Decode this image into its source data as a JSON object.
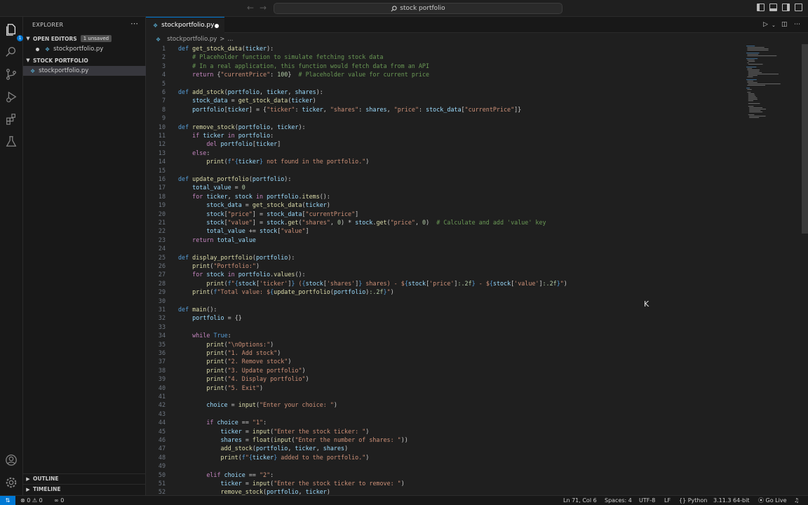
{
  "titlebar": {
    "search_text": "stock portfolio",
    "back_icon": "arrow-left-icon",
    "forward_icon": "arrow-right-icon"
  },
  "activity": {
    "badge": "1"
  },
  "sidebar": {
    "title": "EXPLORER",
    "open_editors_label": "OPEN EDITORS",
    "unsaved_badge": "1 unsaved",
    "open_editor_file": "stockportfolio.py",
    "folder_label": "STOCK PORTFOLIO",
    "folder_file": "stockportfolio.py",
    "outline_label": "OUTLINE",
    "timeline_label": "TIMELINE"
  },
  "tabs": [
    {
      "label": "stockportfolio.py",
      "dirty": true
    }
  ],
  "breadcrumb": {
    "file": "stockportfolio.py",
    "separator": ">",
    "rest": "..."
  },
  "editor": {
    "first_line": 1,
    "lines": [
      [
        [
          "kw",
          "def "
        ],
        [
          "fn",
          "get_stock_data"
        ],
        [
          "",
          "("
        ],
        [
          "var",
          "ticker"
        ],
        [
          "",
          "):"
        ]
      ],
      [
        [
          "",
          "    "
        ],
        [
          "cm",
          "# Placeholder function to simulate fetching stock data"
        ]
      ],
      [
        [
          "",
          "    "
        ],
        [
          "cm",
          "# In a real application, this function would fetch data from an API"
        ]
      ],
      [
        [
          "",
          "    "
        ],
        [
          "ctl",
          "return "
        ],
        [
          "",
          "{"
        ],
        [
          "str",
          "\"currentPrice\""
        ],
        [
          "",
          ": "
        ],
        [
          "num",
          "100"
        ],
        [
          "",
          "}  "
        ],
        [
          "cm",
          "# Placeholder value for current price"
        ]
      ],
      [],
      [
        [
          "kw",
          "def "
        ],
        [
          "fn",
          "add_stock"
        ],
        [
          "",
          "("
        ],
        [
          "var",
          "portfolio"
        ],
        [
          "",
          ", "
        ],
        [
          "var",
          "ticker"
        ],
        [
          "",
          ", "
        ],
        [
          "var",
          "shares"
        ],
        [
          "",
          "):"
        ]
      ],
      [
        [
          "",
          "    "
        ],
        [
          "var",
          "stock_data"
        ],
        [
          "",
          " = "
        ],
        [
          "fn",
          "get_stock_data"
        ],
        [
          "",
          "("
        ],
        [
          "var",
          "ticker"
        ],
        [
          "",
          ")"
        ]
      ],
      [
        [
          "",
          "    "
        ],
        [
          "var",
          "portfolio"
        ],
        [
          "",
          "["
        ],
        [
          "var",
          "ticker"
        ],
        [
          "",
          "] = {"
        ],
        [
          "str",
          "\"ticker\""
        ],
        [
          "",
          ": "
        ],
        [
          "var",
          "ticker"
        ],
        [
          "",
          ", "
        ],
        [
          "str",
          "\"shares\""
        ],
        [
          "",
          ": "
        ],
        [
          "var",
          "shares"
        ],
        [
          "",
          ", "
        ],
        [
          "str",
          "\"price\""
        ],
        [
          "",
          ": "
        ],
        [
          "var",
          "stock_data"
        ],
        [
          "",
          "["
        ],
        [
          "str",
          "\"currentPrice\""
        ],
        [
          "",
          "]}"
        ]
      ],
      [],
      [
        [
          "kw",
          "def "
        ],
        [
          "fn",
          "remove_stock"
        ],
        [
          "",
          "("
        ],
        [
          "var",
          "portfolio"
        ],
        [
          "",
          ", "
        ],
        [
          "var",
          "ticker"
        ],
        [
          "",
          "):"
        ]
      ],
      [
        [
          "",
          "    "
        ],
        [
          "ctl",
          "if "
        ],
        [
          "var",
          "ticker"
        ],
        [
          "ctl",
          " in "
        ],
        [
          "var",
          "portfolio"
        ],
        [
          "",
          ":"
        ]
      ],
      [
        [
          "",
          "        "
        ],
        [
          "ctl",
          "del "
        ],
        [
          "var",
          "portfolio"
        ],
        [
          "",
          "["
        ],
        [
          "var",
          "ticker"
        ],
        [
          "",
          "]"
        ]
      ],
      [
        [
          "",
          "    "
        ],
        [
          "ctl",
          "else"
        ],
        [
          "",
          ":"
        ]
      ],
      [
        [
          "",
          "        "
        ],
        [
          "fn",
          "print"
        ],
        [
          "",
          "("
        ],
        [
          "kw",
          "f"
        ],
        [
          "str",
          "\""
        ],
        [
          "kw",
          "{"
        ],
        [
          "var",
          "ticker"
        ],
        [
          "kw",
          "}"
        ],
        [
          "str",
          " not found in the portfolio.\""
        ],
        [
          "",
          ")"
        ]
      ],
      [],
      [
        [
          "kw",
          "def "
        ],
        [
          "fn",
          "update_portfolio"
        ],
        [
          "",
          "("
        ],
        [
          "var",
          "portfolio"
        ],
        [
          "",
          "):"
        ]
      ],
      [
        [
          "",
          "    "
        ],
        [
          "var",
          "total_value"
        ],
        [
          "",
          " = "
        ],
        [
          "num",
          "0"
        ]
      ],
      [
        [
          "",
          "    "
        ],
        [
          "ctl",
          "for "
        ],
        [
          "var",
          "ticker"
        ],
        [
          "",
          ", "
        ],
        [
          "var",
          "stock"
        ],
        [
          "ctl",
          " in "
        ],
        [
          "var",
          "portfolio"
        ],
        [
          "",
          "."
        ],
        [
          "fn",
          "items"
        ],
        [
          "",
          "():"
        ]
      ],
      [
        [
          "",
          "        "
        ],
        [
          "var",
          "stock_data"
        ],
        [
          "",
          " = "
        ],
        [
          "fn",
          "get_stock_data"
        ],
        [
          "",
          "("
        ],
        [
          "var",
          "ticker"
        ],
        [
          "",
          ")"
        ]
      ],
      [
        [
          "",
          "        "
        ],
        [
          "var",
          "stock"
        ],
        [
          "",
          "["
        ],
        [
          "str",
          "\"price\""
        ],
        [
          "",
          "] = "
        ],
        [
          "var",
          "stock_data"
        ],
        [
          "",
          "["
        ],
        [
          "str",
          "\"currentPrice\""
        ],
        [
          "",
          "]"
        ]
      ],
      [
        [
          "",
          "        "
        ],
        [
          "var",
          "stock"
        ],
        [
          "",
          "["
        ],
        [
          "str",
          "\"value\""
        ],
        [
          "",
          "] = "
        ],
        [
          "var",
          "stock"
        ],
        [
          "",
          "."
        ],
        [
          "fn",
          "get"
        ],
        [
          "",
          "("
        ],
        [
          "str",
          "\"shares\""
        ],
        [
          "",
          ", "
        ],
        [
          "num",
          "0"
        ],
        [
          "",
          ") * "
        ],
        [
          "var",
          "stock"
        ],
        [
          "",
          "."
        ],
        [
          "fn",
          "get"
        ],
        [
          "",
          "("
        ],
        [
          "str",
          "\"price\""
        ],
        [
          "",
          ", "
        ],
        [
          "num",
          "0"
        ],
        [
          "",
          ")  "
        ],
        [
          "cm",
          "# Calculate and add 'value' key"
        ]
      ],
      [
        [
          "",
          "        "
        ],
        [
          "var",
          "total_value"
        ],
        [
          "",
          " += "
        ],
        [
          "var",
          "stock"
        ],
        [
          "",
          "["
        ],
        [
          "str",
          "\"value\""
        ],
        [
          "",
          "]"
        ]
      ],
      [
        [
          "",
          "    "
        ],
        [
          "ctl",
          "return "
        ],
        [
          "var",
          "total_value"
        ]
      ],
      [],
      [
        [
          "kw",
          "def "
        ],
        [
          "fn",
          "display_portfolio"
        ],
        [
          "",
          "("
        ],
        [
          "var",
          "portfolio"
        ],
        [
          "",
          "):"
        ]
      ],
      [
        [
          "",
          "    "
        ],
        [
          "fn",
          "print"
        ],
        [
          "",
          "("
        ],
        [
          "str",
          "\"Portfolio:\""
        ],
        [
          "",
          ")"
        ]
      ],
      [
        [
          "",
          "    "
        ],
        [
          "ctl",
          "for "
        ],
        [
          "var",
          "stock"
        ],
        [
          "ctl",
          " in "
        ],
        [
          "var",
          "portfolio"
        ],
        [
          "",
          "."
        ],
        [
          "fn",
          "values"
        ],
        [
          "",
          "():"
        ]
      ],
      [
        [
          "",
          "        "
        ],
        [
          "fn",
          "print"
        ],
        [
          "",
          "("
        ],
        [
          "kw",
          "f"
        ],
        [
          "str",
          "\""
        ],
        [
          "kw",
          "{"
        ],
        [
          "var",
          "stock"
        ],
        [
          "",
          "["
        ],
        [
          "str",
          "'ticker'"
        ],
        [
          "",
          "]"
        ],
        [
          "kw",
          "}"
        ],
        [
          "str",
          " ("
        ],
        [
          "kw",
          "{"
        ],
        [
          "var",
          "stock"
        ],
        [
          "",
          "["
        ],
        [
          "str",
          "'shares'"
        ],
        [
          "",
          "]"
        ],
        [
          "kw",
          "}"
        ],
        [
          "str",
          " shares) - $"
        ],
        [
          "kw",
          "{"
        ],
        [
          "var",
          "stock"
        ],
        [
          "",
          "["
        ],
        [
          "str",
          "'price'"
        ],
        [
          "",
          "]"
        ],
        [
          "num",
          ":.2f"
        ],
        [
          "kw",
          "}"
        ],
        [
          "str",
          " - $"
        ],
        [
          "kw",
          "{"
        ],
        [
          "var",
          "stock"
        ],
        [
          "",
          "["
        ],
        [
          "str",
          "'value'"
        ],
        [
          "",
          "]"
        ],
        [
          "num",
          ":.2f"
        ],
        [
          "kw",
          "}"
        ],
        [
          "str",
          "\""
        ],
        [
          "",
          ")"
        ]
      ],
      [
        [
          "",
          "    "
        ],
        [
          "fn",
          "print"
        ],
        [
          "",
          "("
        ],
        [
          "kw",
          "f"
        ],
        [
          "str",
          "\"Total value: $"
        ],
        [
          "kw",
          "{"
        ],
        [
          "fn",
          "update_portfolio"
        ],
        [
          "",
          "("
        ],
        [
          "var",
          "portfolio"
        ],
        [
          "",
          ")"
        ],
        [
          "num",
          ":.2f"
        ],
        [
          "kw",
          "}"
        ],
        [
          "str",
          "\""
        ],
        [
          "",
          ")"
        ]
      ],
      [],
      [
        [
          "kw",
          "def "
        ],
        [
          "fn",
          "main"
        ],
        [
          "",
          "():"
        ]
      ],
      [
        [
          "",
          "    "
        ],
        [
          "var",
          "portfolio"
        ],
        [
          "",
          " = {}"
        ]
      ],
      [],
      [
        [
          "",
          "    "
        ],
        [
          "ctl",
          "while "
        ],
        [
          "kw",
          "True"
        ],
        [
          "",
          ":"
        ]
      ],
      [
        [
          "",
          "        "
        ],
        [
          "fn",
          "print"
        ],
        [
          "",
          "("
        ],
        [
          "str",
          "\"\\nOptions:\""
        ],
        [
          "",
          ")"
        ]
      ],
      [
        [
          "",
          "        "
        ],
        [
          "fn",
          "print"
        ],
        [
          "",
          "("
        ],
        [
          "str",
          "\"1. Add stock\""
        ],
        [
          "",
          ")"
        ]
      ],
      [
        [
          "",
          "        "
        ],
        [
          "fn",
          "print"
        ],
        [
          "",
          "("
        ],
        [
          "str",
          "\"2. Remove stock\""
        ],
        [
          "",
          ")"
        ]
      ],
      [
        [
          "",
          "        "
        ],
        [
          "fn",
          "print"
        ],
        [
          "",
          "("
        ],
        [
          "str",
          "\"3. Update portfolio\""
        ],
        [
          "",
          ")"
        ]
      ],
      [
        [
          "",
          "        "
        ],
        [
          "fn",
          "print"
        ],
        [
          "",
          "("
        ],
        [
          "str",
          "\"4. Display portfolio\""
        ],
        [
          "",
          ")"
        ]
      ],
      [
        [
          "",
          "        "
        ],
        [
          "fn",
          "print"
        ],
        [
          "",
          "("
        ],
        [
          "str",
          "\"5. Exit\""
        ],
        [
          "",
          ")"
        ]
      ],
      [],
      [
        [
          "",
          "        "
        ],
        [
          "var",
          "choice"
        ],
        [
          "",
          " = "
        ],
        [
          "fn",
          "input"
        ],
        [
          "",
          "("
        ],
        [
          "str",
          "\"Enter your choice: \""
        ],
        [
          "",
          ")"
        ]
      ],
      [],
      [
        [
          "",
          "        "
        ],
        [
          "ctl",
          "if "
        ],
        [
          "var",
          "choice"
        ],
        [
          "",
          " == "
        ],
        [
          "str",
          "\"1\""
        ],
        [
          "",
          ":"
        ]
      ],
      [
        [
          "",
          "            "
        ],
        [
          "var",
          "ticker"
        ],
        [
          "",
          " = "
        ],
        [
          "fn",
          "input"
        ],
        [
          "",
          "("
        ],
        [
          "str",
          "\"Enter the stock ticker: \""
        ],
        [
          "",
          ")"
        ]
      ],
      [
        [
          "",
          "            "
        ],
        [
          "var",
          "shares"
        ],
        [
          "",
          " = "
        ],
        [
          "fn",
          "float"
        ],
        [
          "",
          "("
        ],
        [
          "fn",
          "input"
        ],
        [
          "",
          "("
        ],
        [
          "str",
          "\"Enter the number of shares: \""
        ],
        [
          "",
          "))"
        ]
      ],
      [
        [
          "",
          "            "
        ],
        [
          "fn",
          "add_stock"
        ],
        [
          "",
          "("
        ],
        [
          "var",
          "portfolio"
        ],
        [
          "",
          ", "
        ],
        [
          "var",
          "ticker"
        ],
        [
          "",
          ", "
        ],
        [
          "var",
          "shares"
        ],
        [
          "",
          ")"
        ]
      ],
      [
        [
          "",
          "            "
        ],
        [
          "fn",
          "print"
        ],
        [
          "",
          "("
        ],
        [
          "kw",
          "f"
        ],
        [
          "str",
          "\""
        ],
        [
          "kw",
          "{"
        ],
        [
          "var",
          "ticker"
        ],
        [
          "kw",
          "}"
        ],
        [
          "str",
          " added to the portfolio.\""
        ],
        [
          "",
          ")"
        ]
      ],
      [],
      [
        [
          "",
          "        "
        ],
        [
          "ctl",
          "elif "
        ],
        [
          "var",
          "choice"
        ],
        [
          "",
          " == "
        ],
        [
          "str",
          "\"2\""
        ],
        [
          "",
          ":"
        ]
      ],
      [
        [
          "",
          "            "
        ],
        [
          "var",
          "ticker"
        ],
        [
          "",
          " = "
        ],
        [
          "fn",
          "input"
        ],
        [
          "",
          "("
        ],
        [
          "str",
          "\"Enter the stock ticker to remove: \""
        ],
        [
          "",
          ")"
        ]
      ],
      [
        [
          "",
          "            "
        ],
        [
          "fn",
          "remove_stock"
        ],
        [
          "",
          "("
        ],
        [
          "var",
          "portfolio"
        ],
        [
          "",
          ", "
        ],
        [
          "var",
          "ticker"
        ],
        [
          "",
          ")"
        ]
      ]
    ]
  },
  "statusbar": {
    "errors": "0",
    "warnings": "0",
    "ports": "0",
    "position": "Ln 71, Col 6",
    "spaces": "Spaces: 4",
    "encoding": "UTF-8",
    "eol": "LF",
    "language": "Python",
    "interpreter": "3.11.3 64-bit",
    "golive": "Go Live"
  },
  "colors": {
    "accent": "#0078d4",
    "background": "#1f1f1f",
    "sidebar": "#181818"
  }
}
